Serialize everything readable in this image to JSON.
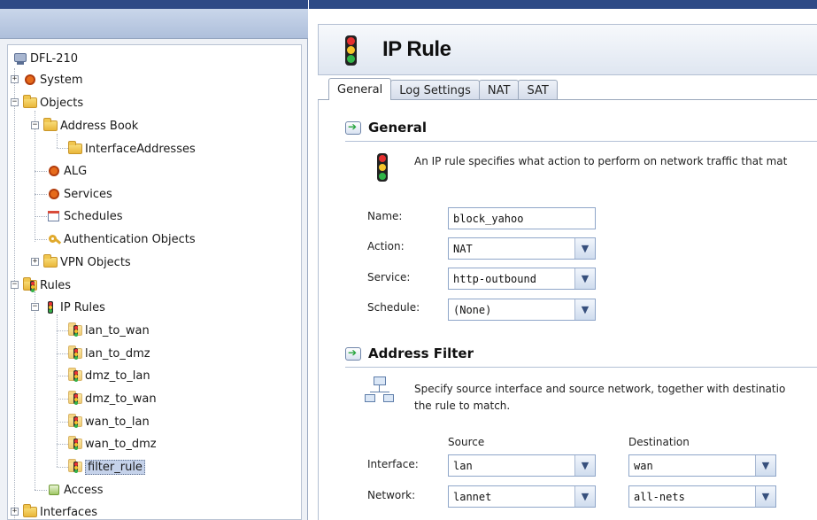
{
  "tree": {
    "root_label": "DFL-210",
    "items": [
      {
        "label": "System"
      },
      {
        "label": "Objects"
      },
      {
        "label": "Address Book"
      },
      {
        "label": "InterfaceAddresses"
      },
      {
        "label": "ALG"
      },
      {
        "label": "Services"
      },
      {
        "label": "Schedules"
      },
      {
        "label": "Authentication Objects"
      },
      {
        "label": "VPN Objects"
      },
      {
        "label": "Rules"
      },
      {
        "label": "IP Rules"
      },
      {
        "label": "lan_to_wan"
      },
      {
        "label": "lan_to_dmz"
      },
      {
        "label": "dmz_to_lan"
      },
      {
        "label": "dmz_to_wan"
      },
      {
        "label": "wan_to_lan"
      },
      {
        "label": "wan_to_dmz"
      },
      {
        "label": "filter_rule"
      },
      {
        "label": "Access"
      },
      {
        "label": "Interfaces"
      }
    ],
    "expander_plus": "+",
    "expander_minus": "−"
  },
  "page": {
    "title": "IP Rule"
  },
  "tabs": [
    {
      "label": "General"
    },
    {
      "label": "Log Settings"
    },
    {
      "label": "NAT"
    },
    {
      "label": "SAT"
    }
  ],
  "general": {
    "heading": "General",
    "description": "An IP rule specifies what action to perform on network traffic that mat",
    "fields": {
      "name_label": "Name:",
      "name_value": "block_yahoo",
      "action_label": "Action:",
      "action_value": "NAT",
      "service_label": "Service:",
      "service_value": "http-outbound",
      "schedule_label": "Schedule:",
      "schedule_value": "(None)"
    }
  },
  "address_filter": {
    "heading": "Address Filter",
    "description_line1": "Specify source interface and source network, together with destinatio",
    "description_line2": "the rule to match.",
    "source_header": "Source",
    "destination_header": "Destination",
    "interface_label": "Interface:",
    "network_label": "Network:",
    "source_interface": "lan",
    "destination_interface": "wan",
    "source_network": "lannet",
    "destination_network": "all-nets"
  },
  "colors": {
    "topbar": "#2e4a86",
    "selection": "#c5d2ea",
    "input_border": "#8fa6c9"
  }
}
